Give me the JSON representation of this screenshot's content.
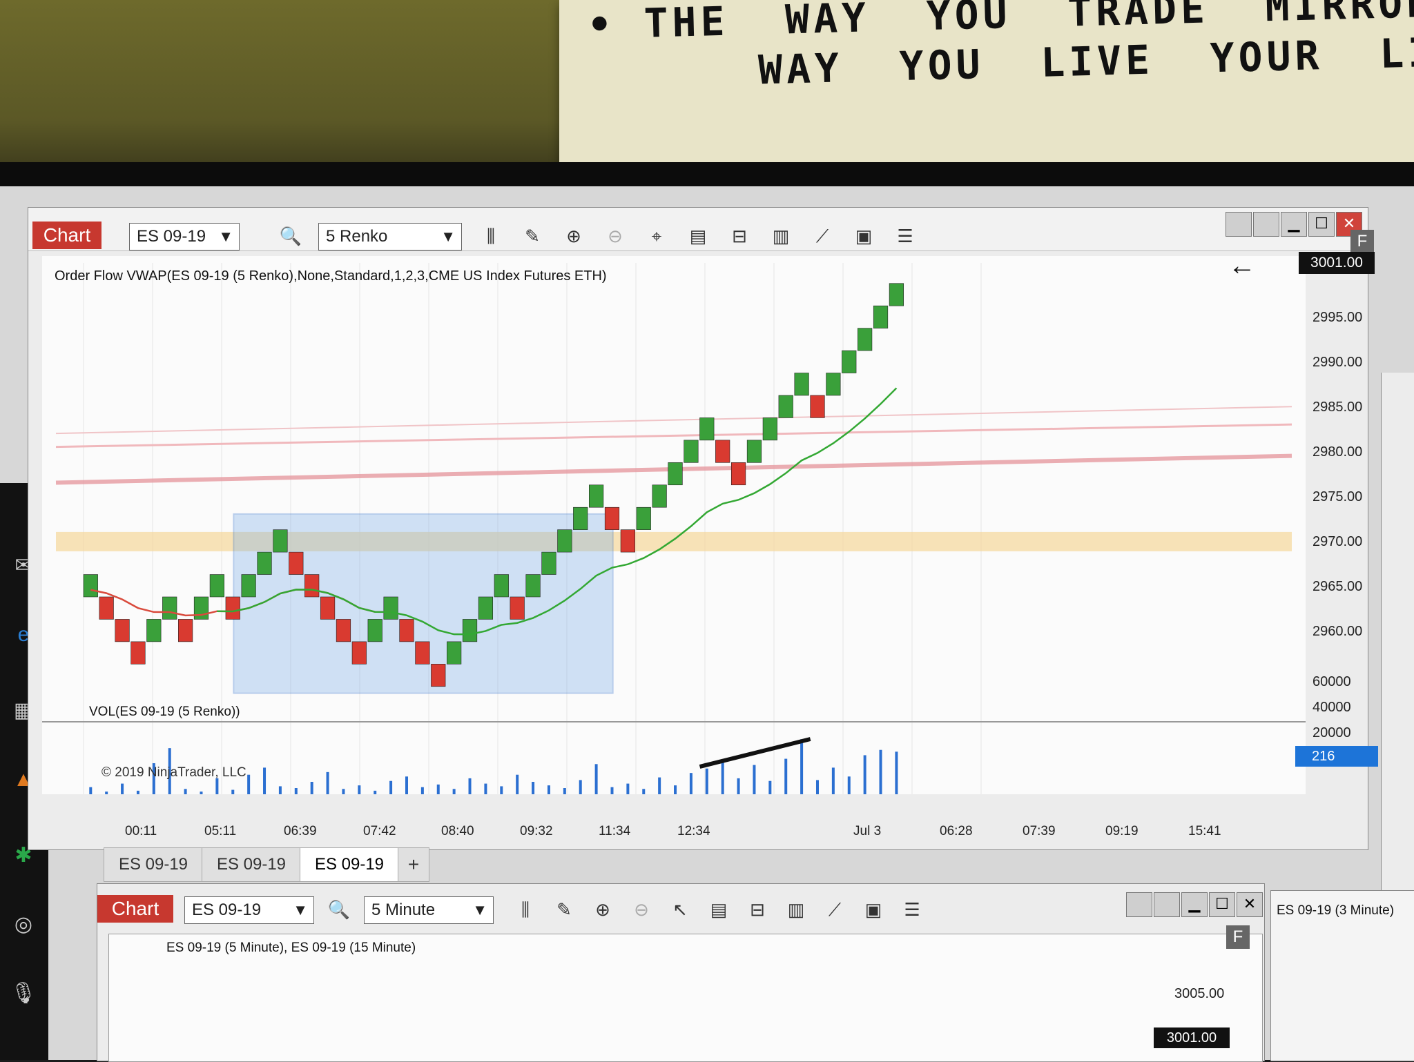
{
  "note": {
    "line1": "• THE  WAY  YOU  TRADE  MIRRORS  THE",
    "line2": "      WAY  YOU  LIVE  YOUR  LIFE"
  },
  "main_chart": {
    "tab_label": "Chart",
    "instrument": "ES 09-19",
    "bar_type": "5 Renko",
    "indicator_label": "Order Flow VWAP(ES 09-19 (5 Renko),None,Standard,1,2,3,CME US Index Futures ETH)",
    "volume_label": "VOL(ES 09-19 (5 Renko))",
    "copyright": "© 2019 NinjaTrader, LLC",
    "price_marker": "3001.00",
    "volume_marker": "216",
    "f_badge": "F",
    "price_axis": [
      "2995.00",
      "2990.00",
      "2985.00",
      "2980.00",
      "2975.00",
      "2970.00",
      "2965.00",
      "2960.00"
    ],
    "volume_axis": [
      "60000",
      "40000",
      "20000"
    ],
    "time_axis": [
      "00:11",
      "05:11",
      "06:39",
      "07:42",
      "08:40",
      "09:32",
      "11:34",
      "12:34",
      "Jul 3",
      "06:28",
      "07:39",
      "09:19",
      "15:41"
    ],
    "tabs": [
      "ES 09-19",
      "ES 09-19",
      "ES 09-19",
      "+"
    ]
  },
  "bottom_chart": {
    "tab_label": "Chart",
    "instrument": "ES 09-19",
    "bar_type": "5 Minute",
    "series_label": "ES 09-19 (5 Minute), ES 09-19 (15 Minute)",
    "price_axis": [
      "3005.00"
    ],
    "price_marker": "3001.00",
    "f_badge": "F"
  },
  "side_panel": {
    "label": "ES 09-19 (3 Minute)"
  },
  "colors": {
    "up_brick": "#3aa03a",
    "down_brick": "#d93a30",
    "vwap_red": "#d94a3c",
    "vwap_green": "#33a833",
    "selection": "#7fb0e8",
    "price_tag": "#111111",
    "volume_tag": "#1d74d8"
  },
  "chart_data": {
    "type": "renko",
    "brick_size": 5,
    "bricks": [
      {
        "dir": "up",
        "close": 2967.5
      },
      {
        "dir": "down",
        "close": 2965
      },
      {
        "dir": "down",
        "close": 2962.5
      },
      {
        "dir": "down",
        "close": 2960
      },
      {
        "dir": "up",
        "close": 2962.5
      },
      {
        "dir": "up",
        "close": 2965
      },
      {
        "dir": "down",
        "close": 2962.5
      },
      {
        "dir": "up",
        "close": 2965
      },
      {
        "dir": "up",
        "close": 2967.5
      },
      {
        "dir": "down",
        "close": 2965
      },
      {
        "dir": "up",
        "close": 2967.5
      },
      {
        "dir": "up",
        "close": 2970
      },
      {
        "dir": "up",
        "close": 2972.5
      },
      {
        "dir": "down",
        "close": 2970
      },
      {
        "dir": "down",
        "close": 2967.5
      },
      {
        "dir": "down",
        "close": 2965
      },
      {
        "dir": "down",
        "close": 2962.5
      },
      {
        "dir": "down",
        "close": 2960
      },
      {
        "dir": "up",
        "close": 2962.5
      },
      {
        "dir": "up",
        "close": 2965
      },
      {
        "dir": "down",
        "close": 2962.5
      },
      {
        "dir": "down",
        "close": 2960
      },
      {
        "dir": "down",
        "close": 2957.5
      },
      {
        "dir": "up",
        "close": 2960
      },
      {
        "dir": "up",
        "close": 2962.5
      },
      {
        "dir": "up",
        "close": 2965
      },
      {
        "dir": "up",
        "close": 2967.5
      },
      {
        "dir": "down",
        "close": 2965
      },
      {
        "dir": "up",
        "close": 2967.5
      },
      {
        "dir": "up",
        "close": 2970
      },
      {
        "dir": "up",
        "close": 2972.5
      },
      {
        "dir": "up",
        "close": 2975
      },
      {
        "dir": "up",
        "close": 2977.5
      },
      {
        "dir": "down",
        "close": 2975
      },
      {
        "dir": "down",
        "close": 2972.5
      },
      {
        "dir": "up",
        "close": 2975
      },
      {
        "dir": "up",
        "close": 2977.5
      },
      {
        "dir": "up",
        "close": 2980
      },
      {
        "dir": "up",
        "close": 2982.5
      },
      {
        "dir": "up",
        "close": 2985
      },
      {
        "dir": "down",
        "close": 2982.5
      },
      {
        "dir": "down",
        "close": 2980
      },
      {
        "dir": "up",
        "close": 2982.5
      },
      {
        "dir": "up",
        "close": 2985
      },
      {
        "dir": "up",
        "close": 2987.5
      },
      {
        "dir": "up",
        "close": 2990
      },
      {
        "dir": "down",
        "close": 2987.5
      },
      {
        "dir": "up",
        "close": 2990
      },
      {
        "dir": "up",
        "close": 2992.5
      },
      {
        "dir": "up",
        "close": 2995
      },
      {
        "dir": "up",
        "close": 2997.5
      },
      {
        "dir": "up",
        "close": 3000
      }
    ],
    "volume": [
      8,
      3,
      12,
      4,
      35,
      52,
      6,
      3,
      18,
      5,
      22,
      30,
      9,
      7,
      14,
      25,
      6,
      10,
      4,
      15,
      20,
      8,
      11,
      6,
      18,
      12,
      9,
      22,
      14,
      10,
      7,
      16,
      34,
      8,
      12,
      6,
      19,
      10,
      24,
      29,
      38,
      18,
      33,
      15,
      40,
      62,
      16,
      30,
      20,
      44,
      50,
      48
    ],
    "y_range": [
      2955,
      3002
    ],
    "volume_range": [
      0,
      70000
    ]
  }
}
